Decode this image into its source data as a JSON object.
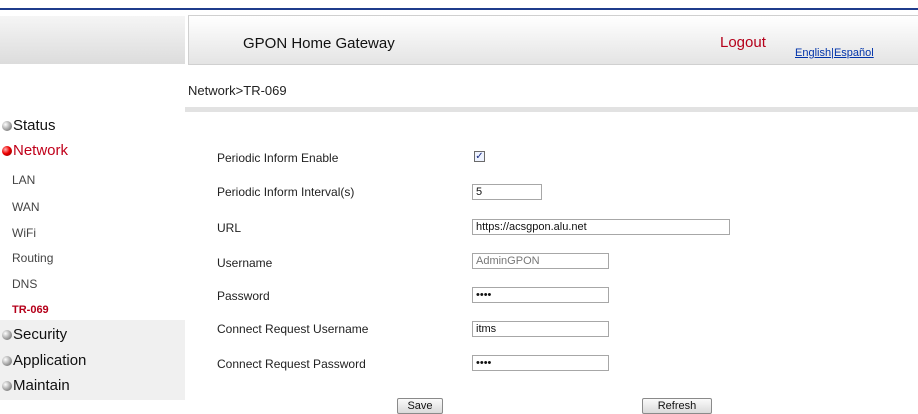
{
  "header": {
    "title": "GPON Home Gateway",
    "logout": "Logout",
    "lang_english": "English",
    "lang_separator": "|",
    "lang_spanish": "Español"
  },
  "breadcrumb": "Network>TR-069",
  "sidebar": {
    "sections": [
      {
        "label": "Status"
      },
      {
        "label": "Network",
        "active": true
      },
      {
        "label": "Security"
      },
      {
        "label": "Application"
      },
      {
        "label": "Maintain"
      }
    ],
    "network_items": [
      "LAN",
      "WAN",
      "WiFi",
      "Routing",
      "DNS",
      "TR-069"
    ],
    "current_item": "TR-069"
  },
  "form": {
    "periodic_inform_enable": {
      "label": "Periodic Inform Enable",
      "checked": true
    },
    "periodic_inform_interval": {
      "label": "Periodic Inform Interval(s)",
      "value": "5"
    },
    "url": {
      "label": "URL",
      "value": "https://acsgpon.alu.net"
    },
    "username": {
      "label": "Username",
      "value": "AdminGPON"
    },
    "password": {
      "label": "Password",
      "value": "••••"
    },
    "connect_request_username": {
      "label": "Connect Request Username",
      "value": "itms"
    },
    "connect_request_password": {
      "label": "Connect Request Password",
      "value": "••••"
    }
  },
  "buttons": {
    "save": "Save",
    "refresh": "Refresh"
  },
  "colors": {
    "accent_red": "#b5001a",
    "link_blue": "#0033aa"
  }
}
